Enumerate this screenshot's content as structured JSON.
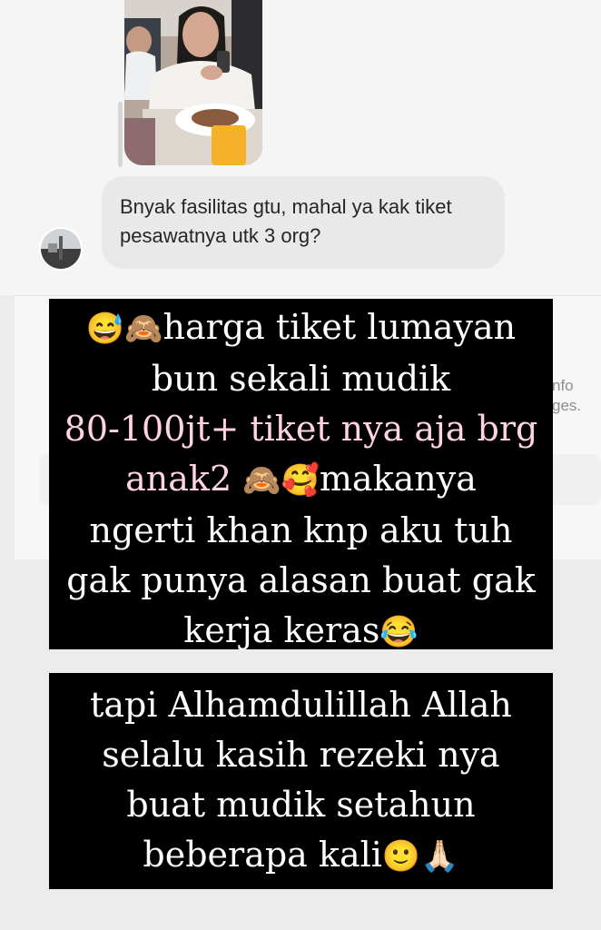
{
  "chat": {
    "message": "Bnyak fasilitas gtu, mahal ya kak tiket pesawatnya utk 3 org?",
    "side_text": [
      "nfo",
      "ges."
    ]
  },
  "story": {
    "box1_lines": [
      {
        "segments": [
          {
            "t": "😅🙈"
          },
          {
            "t": "harga tiket lumayan"
          }
        ]
      },
      {
        "segments": [
          {
            "t": "bun sekali mudik"
          }
        ]
      },
      {
        "segments": [
          {
            "t": "80-100jt+ tiket nya aja brg",
            "pink": true
          }
        ]
      },
      {
        "segments": [
          {
            "t": "anak2 ",
            "pink": true
          },
          {
            "t": "🙈🥰"
          },
          {
            "t": "makanya"
          }
        ]
      },
      {
        "segments": [
          {
            "t": "ngerti khan knp aku tuh"
          }
        ]
      },
      {
        "segments": [
          {
            "t": "gak punya alasan buat gak"
          }
        ]
      },
      {
        "segments": [
          {
            "t": "kerja keras"
          },
          {
            "t": "😂"
          }
        ]
      }
    ],
    "box2_lines": [
      {
        "segments": [
          {
            "t": "tapi Alhamdulillah Allah"
          }
        ]
      },
      {
        "segments": [
          {
            "t": "selalu kasih rezeki nya"
          }
        ]
      },
      {
        "segments": [
          {
            "t": "buat mudik setahun"
          }
        ]
      },
      {
        "segments": [
          {
            "t": "beberapa kali"
          },
          {
            "t": "🙂🙏🏻"
          }
        ]
      }
    ]
  }
}
